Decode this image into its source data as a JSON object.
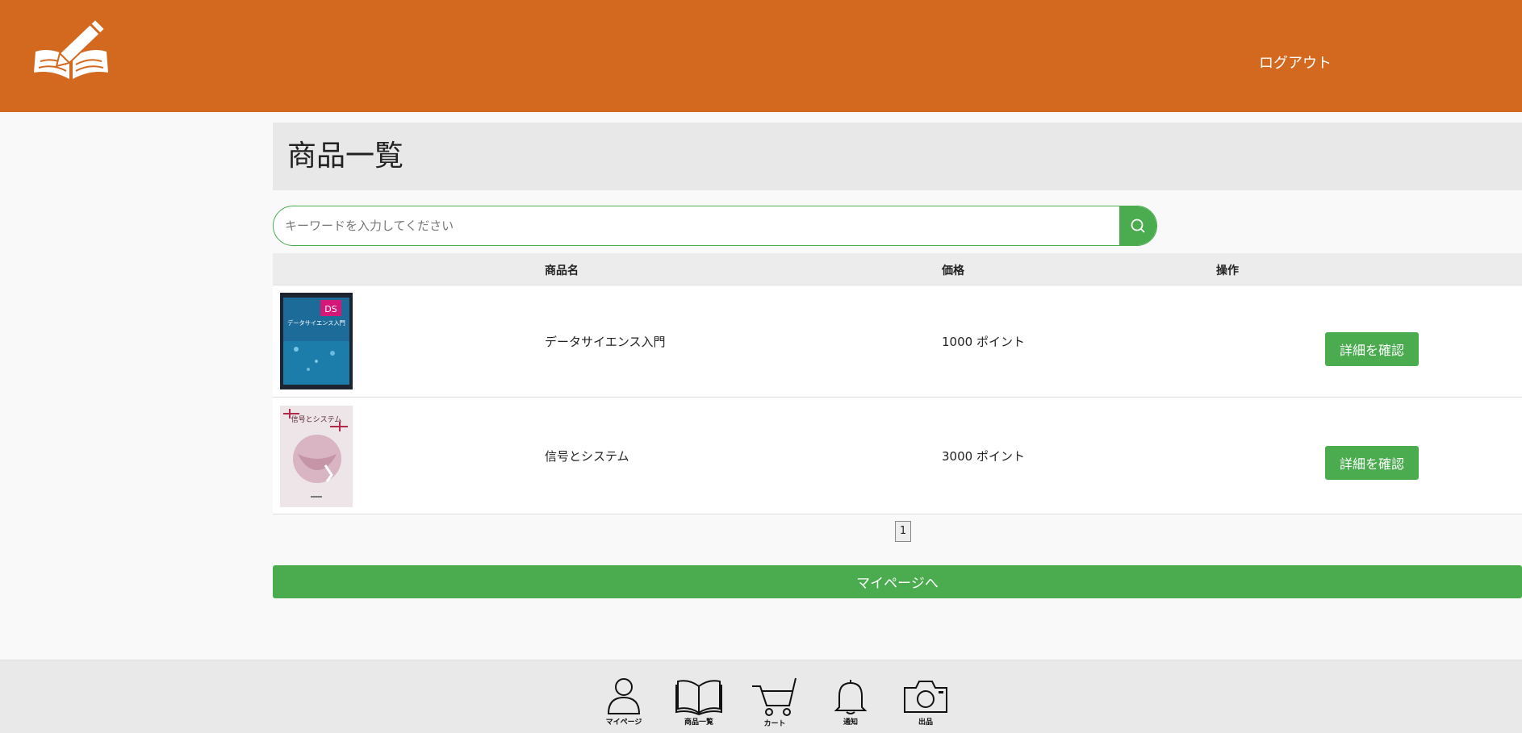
{
  "header": {
    "logo_icon": "book-pencil-icon",
    "logout_label": "ログアウト",
    "bg_color": "#d3691f"
  },
  "main": {
    "page_title": "商品一覧",
    "search": {
      "placeholder": "キーワードを入力してください",
      "value": "",
      "button_icon": "search-icon"
    },
    "table": {
      "headers": [
        "商品名",
        "価格",
        "操作"
      ],
      "rows": [
        {
          "name": "データサイエンス入門",
          "price": "1000 ポイント",
          "action": "詳細を確認",
          "thumb_icon": "book-cover-data-science"
        },
        {
          "name": "信号とシステム",
          "price": "3000 ポイント",
          "action": "詳細を確認",
          "thumb_icon": "book-cover-signals-systems"
        }
      ]
    },
    "pagination": {
      "current_page": "1"
    },
    "mypage_button": "マイページへ",
    "accent_color": "#4aab4f"
  },
  "footer": {
    "nav": [
      {
        "label": "マイページ",
        "icon": "user-icon"
      },
      {
        "label": "商品一覧",
        "icon": "book-icon"
      },
      {
        "label": "カート",
        "icon": "cart-icon"
      },
      {
        "label": "通知",
        "icon": "bell-icon"
      },
      {
        "label": "出品",
        "icon": "camera-icon"
      }
    ]
  },
  "thumbnails": {
    "book1_cover_title": "データサイエンス入門",
    "book1_badge": "DS",
    "book2_cover_title": "信号とシステム"
  }
}
